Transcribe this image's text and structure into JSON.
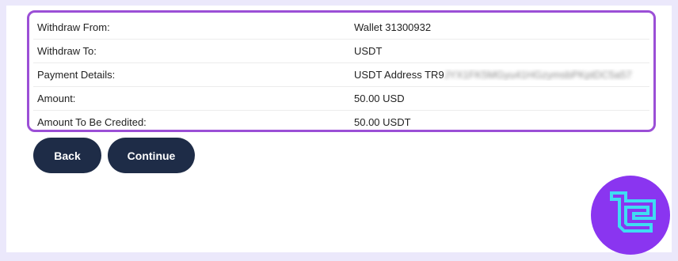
{
  "details": {
    "rows": [
      {
        "label": "Withdraw From:",
        "value": "Wallet 31300932"
      },
      {
        "label": "Withdraw To:",
        "value": "USDT"
      },
      {
        "label": "Payment Details:",
        "value": "USDT Address TR9",
        "value_blurred": "JYX1FK5MGyu41HGzymsbPKptDC5a57"
      },
      {
        "label": "Amount:",
        "value": "50.00 USD"
      },
      {
        "label": "Amount To Be Credited:",
        "value": "50.00 USDT"
      }
    ]
  },
  "buttons": {
    "back": "Back",
    "continue": "Continue"
  },
  "colors": {
    "accent_border": "#9b4fd6",
    "button_bg": "#1e2c47",
    "logo_bg": "#8a35f0",
    "logo_mark": "#3fdcf3"
  },
  "logo": {
    "icon": "tc-brand-logo-icon"
  }
}
